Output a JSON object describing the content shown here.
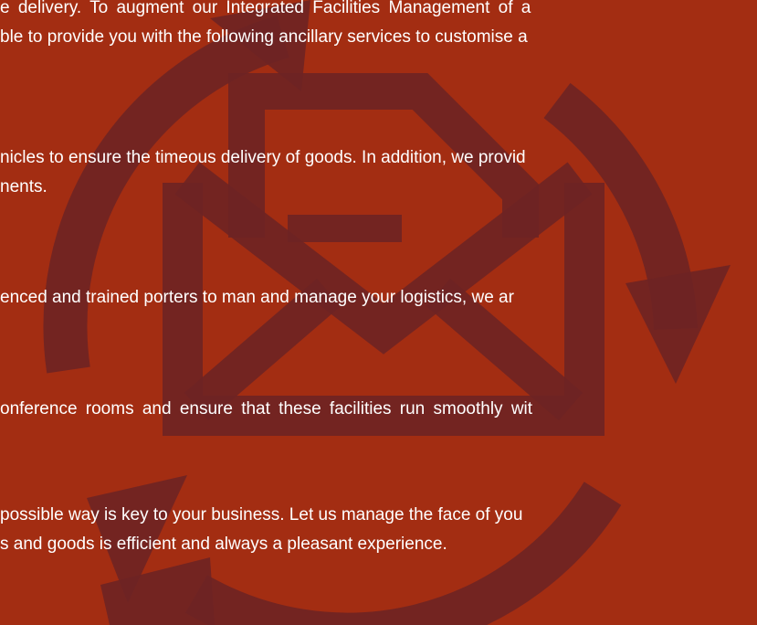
{
  "colors": {
    "background": "#a32d12",
    "icon": "#6e2424",
    "text": "#ffffff"
  },
  "icon": "envelope-refresh-icon",
  "paragraphs": [
    {
      "lines": [
        "e delivery. To augment our Integrated Facilities Management of a",
        "ble to provide you with the following ancillary services to customise a"
      ]
    },
    {
      "lines": [
        "nicles to ensure the timeous delivery of goods. In addition, we provid",
        "nents."
      ]
    },
    {
      "lines": [
        "enced and trained porters to man and manage your logistics, we ar"
      ]
    },
    {
      "lines": [
        "onference rooms and ensure that these facilities run smoothly wit"
      ]
    },
    {
      "lines": [
        "possible way is key to your business. Let us manage the face of you",
        "s and goods is efficient and always a pleasant experience."
      ]
    }
  ]
}
